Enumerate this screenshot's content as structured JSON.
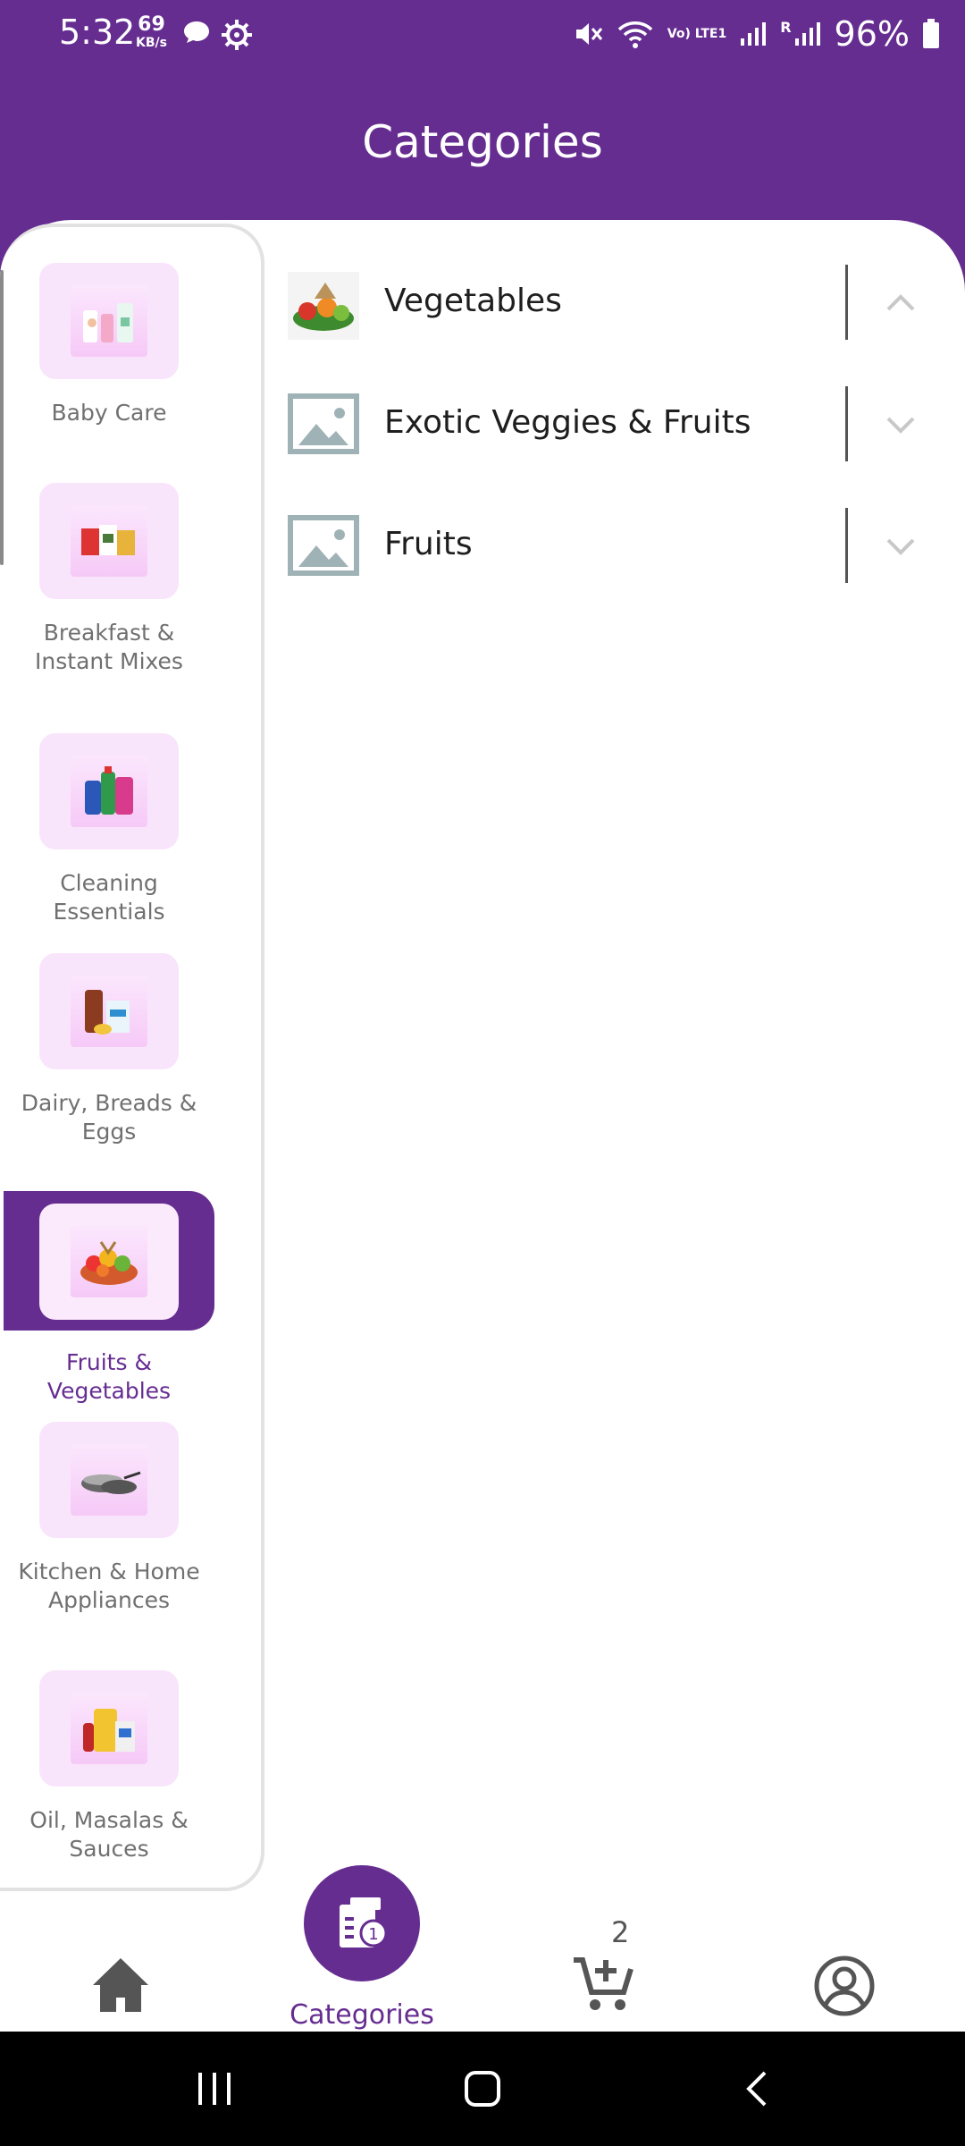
{
  "status_bar": {
    "time": "5:32",
    "speed_value": "69",
    "speed_unit": "KB/s",
    "battery": "96%",
    "network_label": "Vo) LTE1",
    "roaming": "R"
  },
  "header": {
    "title": "Categories"
  },
  "sidebar": {
    "items": [
      {
        "label": "Baby Care",
        "active": false
      },
      {
        "label": "Breakfast & Instant Mixes",
        "active": false
      },
      {
        "label": "Cleaning Essentials",
        "active": false
      },
      {
        "label": "Dairy, Breads & Eggs",
        "active": false
      },
      {
        "label": "Fruits & Vegetables",
        "active": true
      },
      {
        "label": "Kitchen & Home Appliances",
        "active": false
      },
      {
        "label": "Oil, Masalas & Sauces",
        "active": false
      }
    ]
  },
  "subcategories": [
    {
      "name": "Vegetables",
      "expanded": true,
      "thumb": "vegetables-photo"
    },
    {
      "name": "Exotic Veggies & Fruits",
      "expanded": false,
      "thumb": "placeholder-image-icon"
    },
    {
      "name": "Fruits",
      "expanded": false,
      "thumb": "placeholder-image-icon"
    }
  ],
  "bottom_nav": {
    "categories_label": "Categories",
    "cart_count": "2"
  },
  "colors": {
    "brand": "#662d91",
    "tile_bg": "#f9e5fb",
    "label_gray": "#707070"
  }
}
